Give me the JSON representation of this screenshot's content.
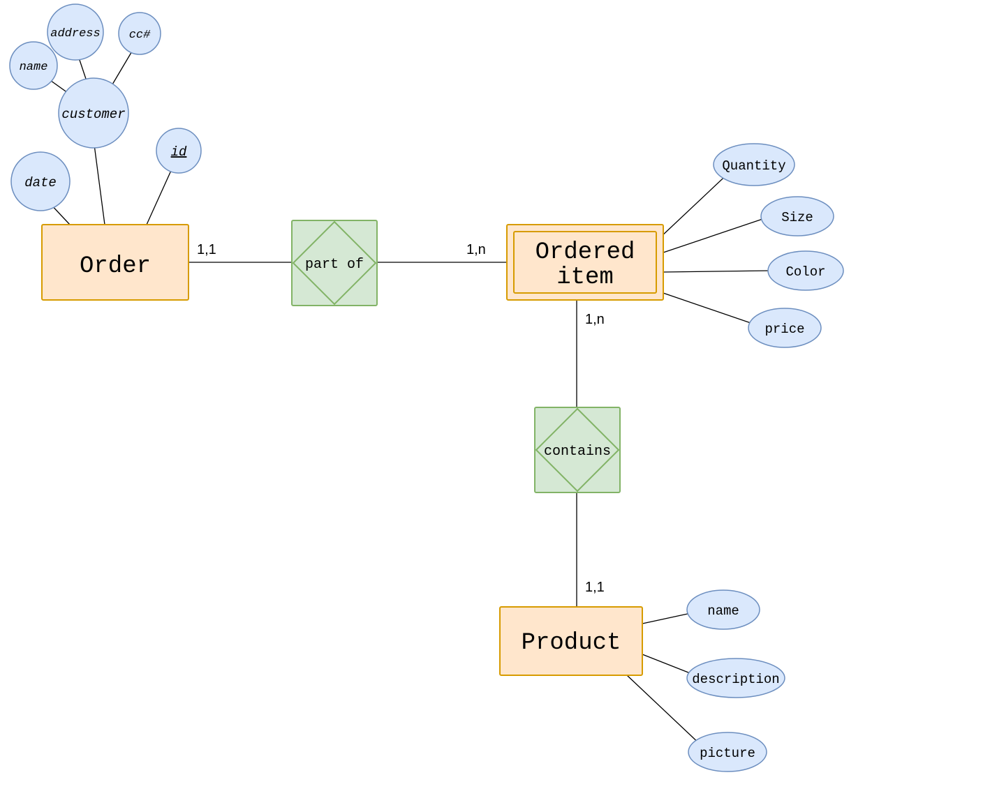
{
  "entities": {
    "order": "Order",
    "ordered_item_l1": "Ordered",
    "ordered_item_l2": "item",
    "product": "Product"
  },
  "relationships": {
    "part_of": "part of",
    "contains": "contains"
  },
  "attributes": {
    "order": {
      "date": "date",
      "customer": "customer",
      "id": "id",
      "name": "name",
      "address": "address",
      "cc": "cc#"
    },
    "ordered_item": {
      "quantity": "Quantity",
      "size": "Size",
      "color": "Color",
      "price": "price"
    },
    "product": {
      "name": "name",
      "description": "description",
      "picture": "picture"
    }
  },
  "cardinalities": {
    "order_partof": "1,1",
    "partof_ordereditem": "1,n",
    "ordereditem_contains": "1,n",
    "contains_product": "1,1"
  },
  "colors": {
    "entity_fill": "#ffe6cc",
    "entity_stroke": "#d79b00",
    "rel_fill": "#d5e8d4",
    "rel_stroke": "#82b366",
    "attr_fill": "#dae8fc",
    "attr_stroke": "#6c8ebf"
  }
}
